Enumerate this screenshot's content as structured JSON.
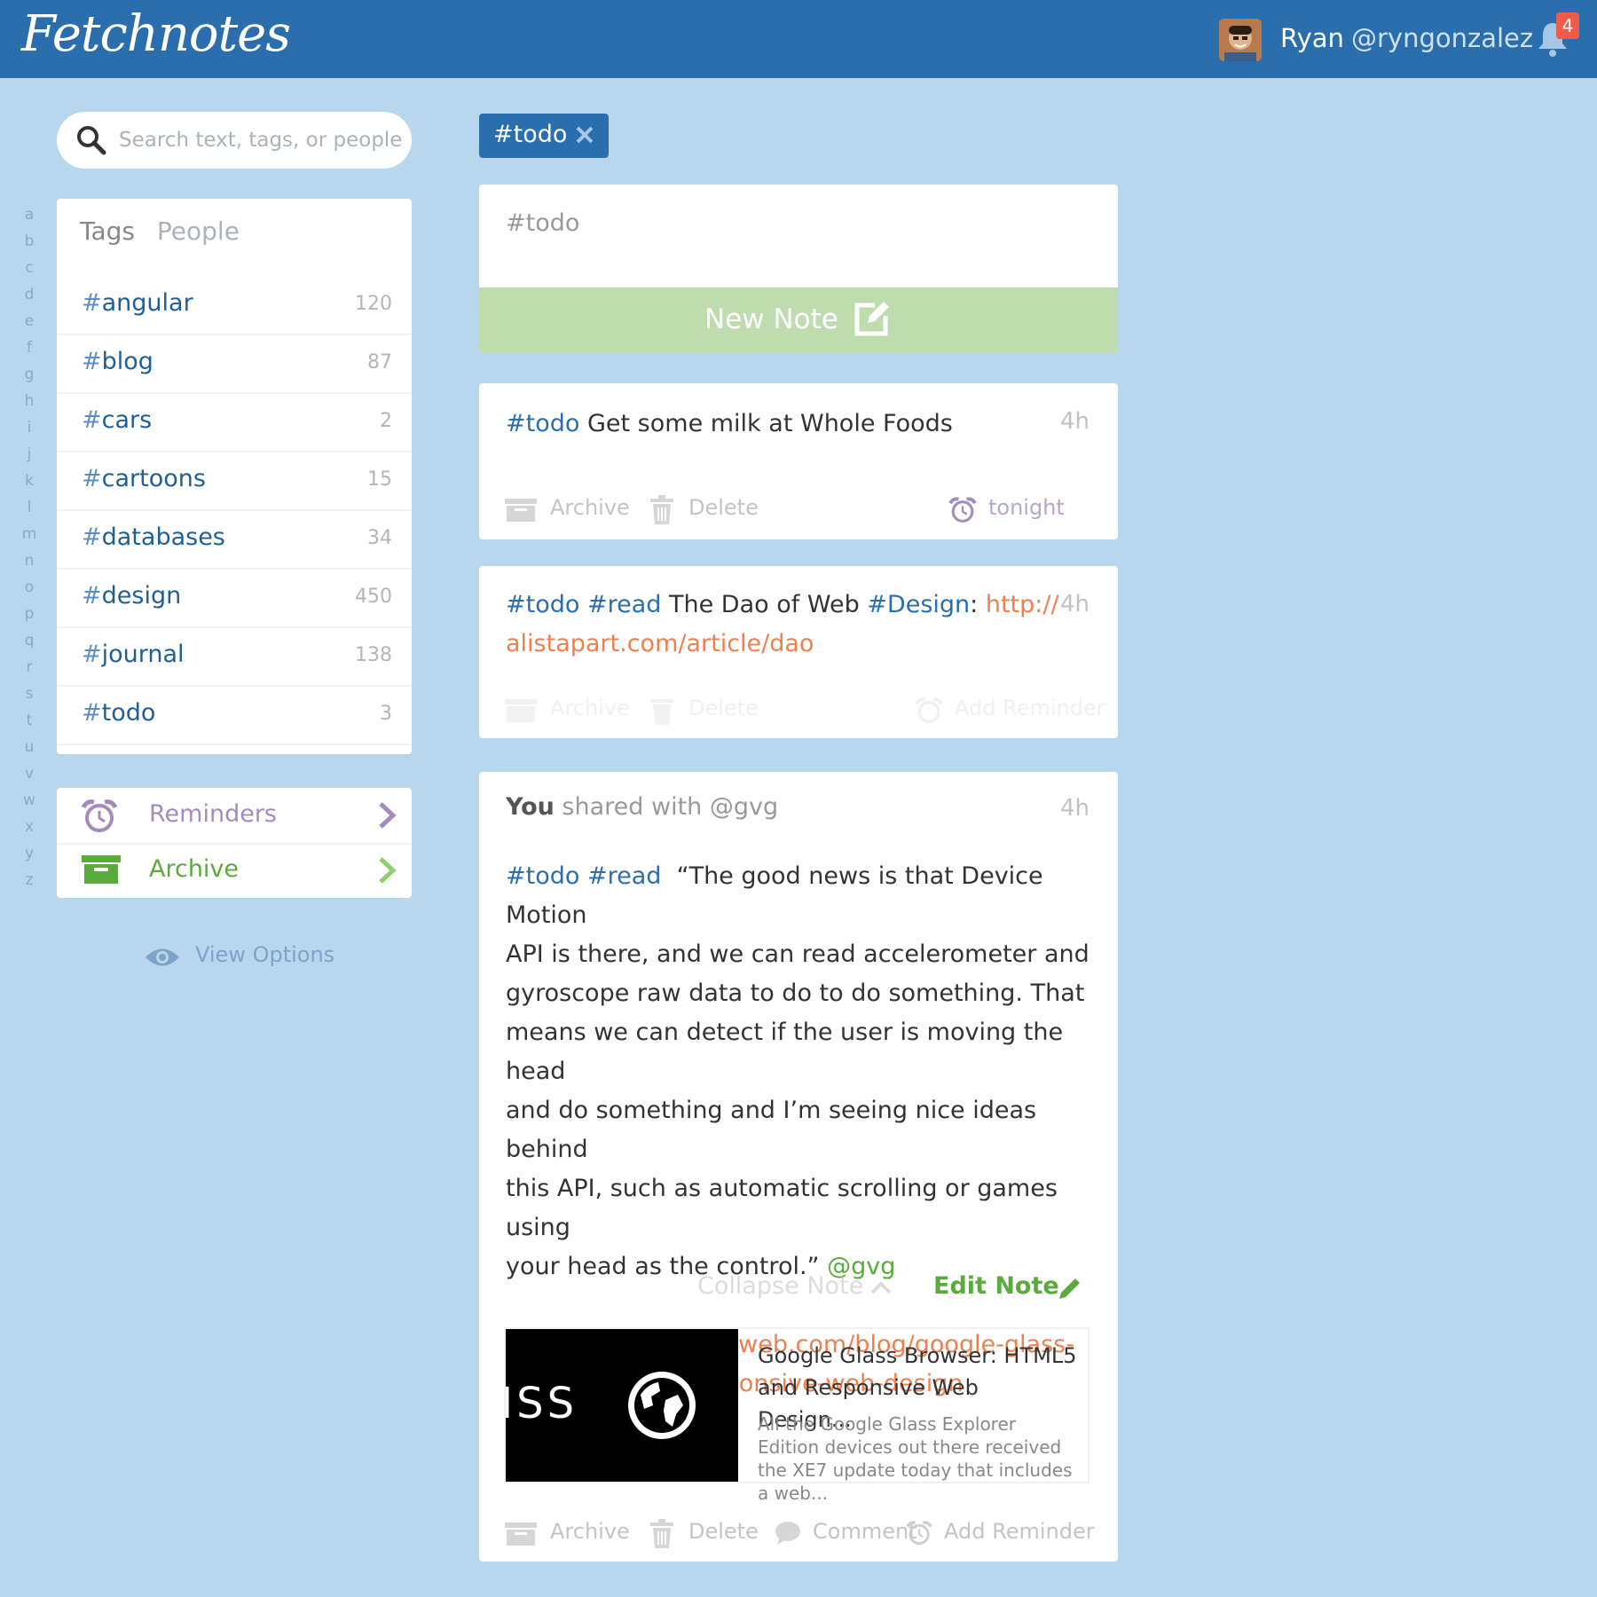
{
  "header": {
    "logo": "Fetchnotes",
    "user_name": "Ryan",
    "user_handle": "@ryngonzalez",
    "notification_count": "4"
  },
  "search": {
    "placeholder": "Search text, tags, or people"
  },
  "alphabet": [
    "a",
    "b",
    "c",
    "d",
    "e",
    "f",
    "g",
    "h",
    "i",
    "j",
    "k",
    "l",
    "m",
    "n",
    "o",
    "p",
    "q",
    "r",
    "s",
    "t",
    "u",
    "v",
    "w",
    "x",
    "y",
    "z"
  ],
  "sidebar": {
    "tab_tags": "Tags",
    "tab_people": "People",
    "tags": [
      {
        "hash": "#",
        "name": "angular",
        "count": "120"
      },
      {
        "hash": "#",
        "name": "blog",
        "count": "87"
      },
      {
        "hash": "#",
        "name": "cars",
        "count": "2"
      },
      {
        "hash": "#",
        "name": "cartoons",
        "count": "15"
      },
      {
        "hash": "#",
        "name": "databases",
        "count": "34"
      },
      {
        "hash": "#",
        "name": "design",
        "count": "450"
      },
      {
        "hash": "#",
        "name": "journal",
        "count": "138"
      },
      {
        "hash": "#",
        "name": "todo",
        "count": "3"
      }
    ],
    "reminders_label": "Reminders",
    "archive_label": "Archive",
    "view_options": "View Options"
  },
  "filter": {
    "label": "#todo"
  },
  "composer": {
    "text": "#todo",
    "new_note_label": "New Note"
  },
  "notes": [
    {
      "tag1": "#todo",
      "text": " Get some milk at Whole Foods",
      "time": "4h",
      "archive": "Archive",
      "delete": "Delete",
      "reminder": "tonight"
    },
    {
      "tag1": "#todo",
      "tag2": "#read",
      "text": " The Dao of Web ",
      "tag3": "#Design",
      "colon": ":",
      "link_line1": "http://",
      "link_line2": "alistapart.com/article/dao",
      "time": "4h",
      "archive": "Archive",
      "delete": "Delete",
      "reminder": "Add Reminder"
    },
    {
      "you": "You",
      "shared": " shared with @gvg",
      "time": "4h",
      "tag1": "#todo",
      "tag2": "#read",
      "lines": [
        "“The good news is that Device Motion",
        "API is there, and we can read accelerometer and",
        "gyroscope raw data to do to do something. That",
        "means we can detect if the user is moving the head",
        "and do something and I’m seeing nice ideas behind",
        "this API, such as automatic scrolling or games using",
        "your head as the control.”"
      ],
      "mention": "@gvg",
      "link_line1": "http://www.mobilexweb.com/blog/google-glass-",
      "link_line2": "browser-html5-responsive-web-design",
      "collapse": "Collapse Note",
      "edit": "Edit Note",
      "preview_title": "Google Glass Browser: HTML5 and Responsive Web Design...",
      "preview_desc": "All the Google Glass Explorer Edition devices out there received the XE7 update today that includes a web...",
      "preview_img_text": "ISS",
      "archive": "Archive",
      "delete": "Delete",
      "comment": "Comment",
      "reminder": "Add Reminder"
    }
  ],
  "colors": {
    "header": "#2a6eae",
    "background": "#b8d6ee",
    "tag": "#2a6eae",
    "link": "#ee8050",
    "mention": "#5aab3c",
    "new_note": "#bfdcae",
    "reminder": "#a48bbd",
    "archive": "#5aab3c",
    "badge": "#ef5c4a"
  }
}
